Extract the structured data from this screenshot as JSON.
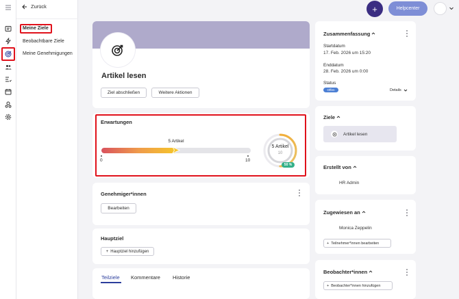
{
  "nav": {
    "back_label": "Zurück",
    "items": [
      "Meine Ziele",
      "Beobachtbare Ziele",
      "Meine Genehmigungen"
    ]
  },
  "topbar": {
    "plus_label": "+",
    "help_label": "Helpcenter"
  },
  "goal": {
    "title": "Artikel lesen",
    "close_label": "Ziel abschließen",
    "more_label": "Weitere Aktionen"
  },
  "expectations": {
    "title": "Erwartungen",
    "current_label": "5 Artikel",
    "min": 0,
    "max": 10,
    "current": 5,
    "min_label": "0",
    "max_label": "10",
    "gauge_value": "5 Artikel",
    "gauge_target": "10",
    "percent_label": "50 %"
  },
  "approvers": {
    "title": "Genehmiger*innen",
    "edit_label": "Bearbeiten"
  },
  "main_goal": {
    "title": "Hauptziel",
    "add_label": "Hauptziel hinzufügen"
  },
  "tabs": [
    "Teilziele",
    "Kommentare",
    "Historie"
  ],
  "summary": {
    "title": "Zusammenfassung",
    "start_label": "Startdatum",
    "start_value": "17. Feb. 2026 um 15:20",
    "end_label": "Enddatum",
    "end_value": "28. Feb. 2026 um 0:00",
    "status_label": "Status",
    "status_value": "Offen",
    "details_label": "Details"
  },
  "goals": {
    "title": "Ziele",
    "item": "Artikel lesen"
  },
  "created_by": {
    "title": "Erstellt von",
    "name": "HR Admin"
  },
  "assigned_to": {
    "title": "Zugewiesen an",
    "name": "Monica Zeppelin",
    "edit_label": "Teilnehmer*innen bearbeiten"
  },
  "observers": {
    "title": "Beobachter*innen",
    "add_label": "Beobachter*innen hinzufügen"
  },
  "colors": {
    "primary": "#3b2e82",
    "help": "#7e8ed6",
    "banner": "#afaacb",
    "highlight": "#e0101a",
    "progress_start": "#d9525e",
    "progress_end": "#f5c52b",
    "success": "#33b089",
    "status": "#4c7fd4",
    "tab_active": "#2b3d9c"
  }
}
